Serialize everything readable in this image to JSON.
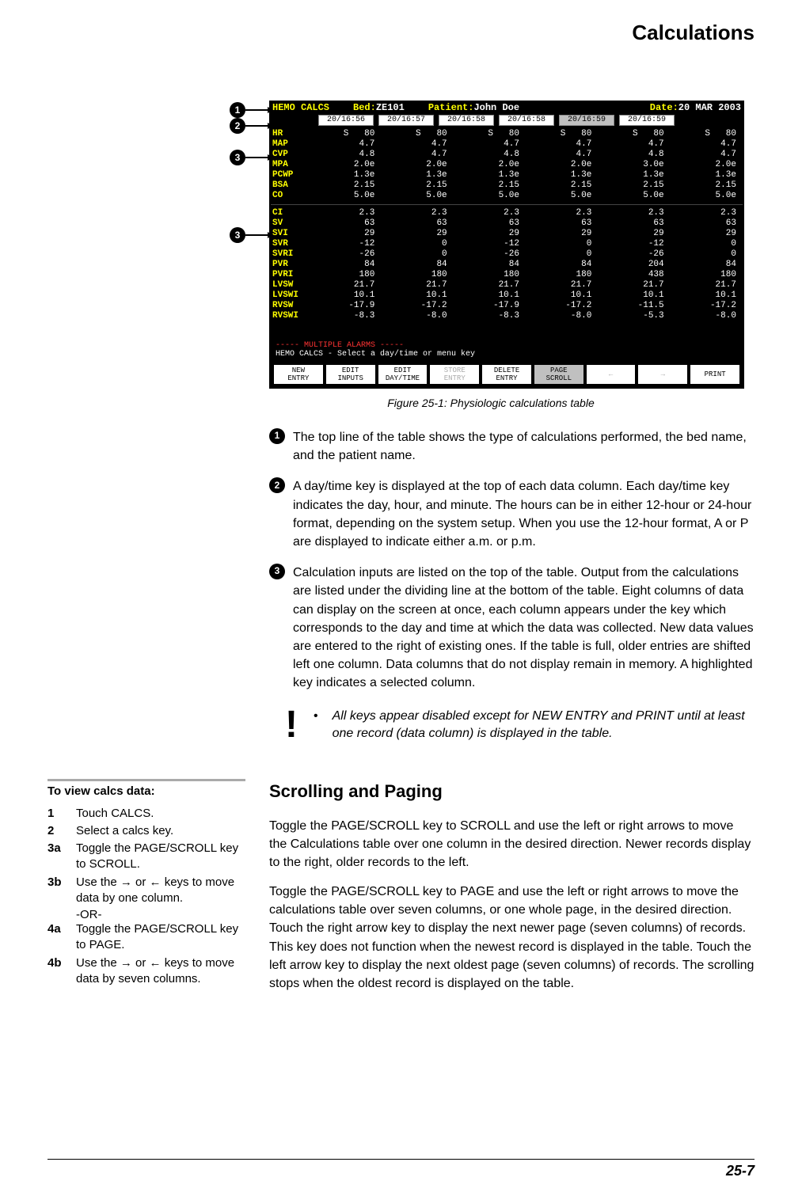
{
  "header": {
    "title": "Calculations"
  },
  "monitor": {
    "title_section": "HEMO CALCS",
    "bed_label": "Bed:",
    "bed_value": "ZE101",
    "patient_label": "Patient:",
    "patient_value": "John Doe",
    "date_label": "Date:",
    "date_value": "20 MAR 2003",
    "time_keys": [
      "20/16:56",
      "20/16:57",
      "20/16:58",
      "20/16:58",
      "20/16:59",
      "20/16:59"
    ],
    "selected_time_index": 4,
    "input_labels": [
      "HR",
      "MAP",
      "CVP",
      "MPA",
      "PCWP",
      "BSA",
      "CO"
    ],
    "output_labels": [
      "CI",
      "SV",
      "SVI",
      "SVR",
      "SVRI",
      "PVR",
      "PVRI",
      "LVSW",
      "LVSWI",
      "RVSW",
      "RVSWI"
    ],
    "cols_s_marker": "S",
    "input_cols": [
      [
        "80",
        "4.7",
        "4.8",
        "2.0e",
        "1.3e",
        "2.15",
        "5.0e"
      ],
      [
        "80",
        "4.7",
        "4.7",
        "2.0e",
        "1.3e",
        "2.15",
        "5.0e"
      ],
      [
        "80",
        "4.7",
        "4.8",
        "2.0e",
        "1.3e",
        "2.15",
        "5.0e"
      ],
      [
        "80",
        "4.7",
        "4.7",
        "2.0e",
        "1.3e",
        "2.15",
        "5.0e"
      ],
      [
        "80",
        "4.7",
        "4.8",
        "3.0e",
        "1.3e",
        "2.15",
        "5.0e"
      ],
      [
        "80",
        "4.7",
        "4.7",
        "2.0e",
        "1.3e",
        "2.15",
        "5.0e"
      ]
    ],
    "output_cols": [
      [
        "2.3",
        "63",
        "29",
        "-12",
        "-26",
        "84",
        "180",
        "21.7",
        "10.1",
        "-17.9",
        "-8.3"
      ],
      [
        "2.3",
        "63",
        "29",
        "0",
        "0",
        "84",
        "180",
        "21.7",
        "10.1",
        "-17.2",
        "-8.0"
      ],
      [
        "2.3",
        "63",
        "29",
        "-12",
        "-26",
        "84",
        "180",
        "21.7",
        "10.1",
        "-17.9",
        "-8.3"
      ],
      [
        "2.3",
        "63",
        "29",
        "0",
        "0",
        "84",
        "180",
        "21.7",
        "10.1",
        "-17.2",
        "-8.0"
      ],
      [
        "2.3",
        "63",
        "29",
        "-12",
        "-26",
        "204",
        "438",
        "21.7",
        "10.1",
        "-11.5",
        "-5.3"
      ],
      [
        "2.3",
        "63",
        "29",
        "0",
        "0",
        "84",
        "180",
        "21.7",
        "10.1",
        "-17.2",
        "-8.0"
      ]
    ],
    "alarm_text": "----- MULTIPLE ALARMS -----",
    "hint_text": "HEMO CALCS - Select a day/time or menu key",
    "softkeys": [
      "NEW\nENTRY",
      "EDIT\nINPUTS",
      "EDIT\nDAY/TIME",
      "STORE\nENTRY",
      "DELETE\nENTRY",
      "PAGE\nSCROLL",
      "←",
      "→",
      "PRINT"
    ]
  },
  "figure_caption": "Figure 25-1: Physiologic calculations table",
  "callouts": [
    {
      "n": "1",
      "text": "The top line of the table shows the type of calculations performed, the bed name, and the patient name."
    },
    {
      "n": "2",
      "text": "A day/time key is displayed at the top of each data column. Each day/time key indicates the day, hour, and minute. The hours can be in either 12-hour or 24-hour format, depending on the system setup. When you use the 12-hour format, A or P are displayed to indicate either a.m. or p.m."
    },
    {
      "n": "3",
      "text": "Calculation inputs are listed on the top of the table. Output from the calculations are listed under the dividing line at the bottom of the table. Eight columns of data can display on the screen at once, each column appears under the key which corresponds to the day and time at which the data was collected. New data values are entered to the right of existing ones. If the table is full, older entries are shifted left one column. Data columns that do not display remain in memory. A highlighted key indicates a selected column."
    }
  ],
  "note": "All keys appear disabled except for NEW ENTRY and PRINT until at least one record (data column) is displayed in the table.",
  "sidebar": {
    "title": "To view calcs data:",
    "steps": [
      {
        "n": "1",
        "t": "Touch CALCS."
      },
      {
        "n": "2",
        "t": "Select a calcs key."
      },
      {
        "n": "3a",
        "t": "Toggle the PAGE/SCROLL key to SCROLL."
      },
      {
        "n": "3b",
        "t": "Use the  → or  ← keys to move data by one column."
      },
      {
        "n": "",
        "t": "-OR-"
      },
      {
        "n": "4a",
        "t": "Toggle the PAGE/SCROLL key to PAGE."
      },
      {
        "n": "4b",
        "t": "Use the  → or  ← keys to move data by seven columns."
      }
    ]
  },
  "section": {
    "heading": "Scrolling and Paging",
    "p1": "Toggle the PAGE/SCROLL key to SCROLL and use the left or right arrows to move the Calculations table over one column in the desired direction. Newer records display to the right, older records to the left.",
    "p2": "Toggle the PAGE/SCROLL key to PAGE and use the left or right arrows to move the calculations table over seven columns, or one whole page, in the desired direction. Touch the right arrow key to display the next newer page (seven columns) of records. This key does not function when the newest record is displayed in the table. Touch the left arrow key to display the next oldest page (seven columns) of records. The scrolling stops when the oldest record is displayed on the table."
  },
  "page_number": "25-7"
}
